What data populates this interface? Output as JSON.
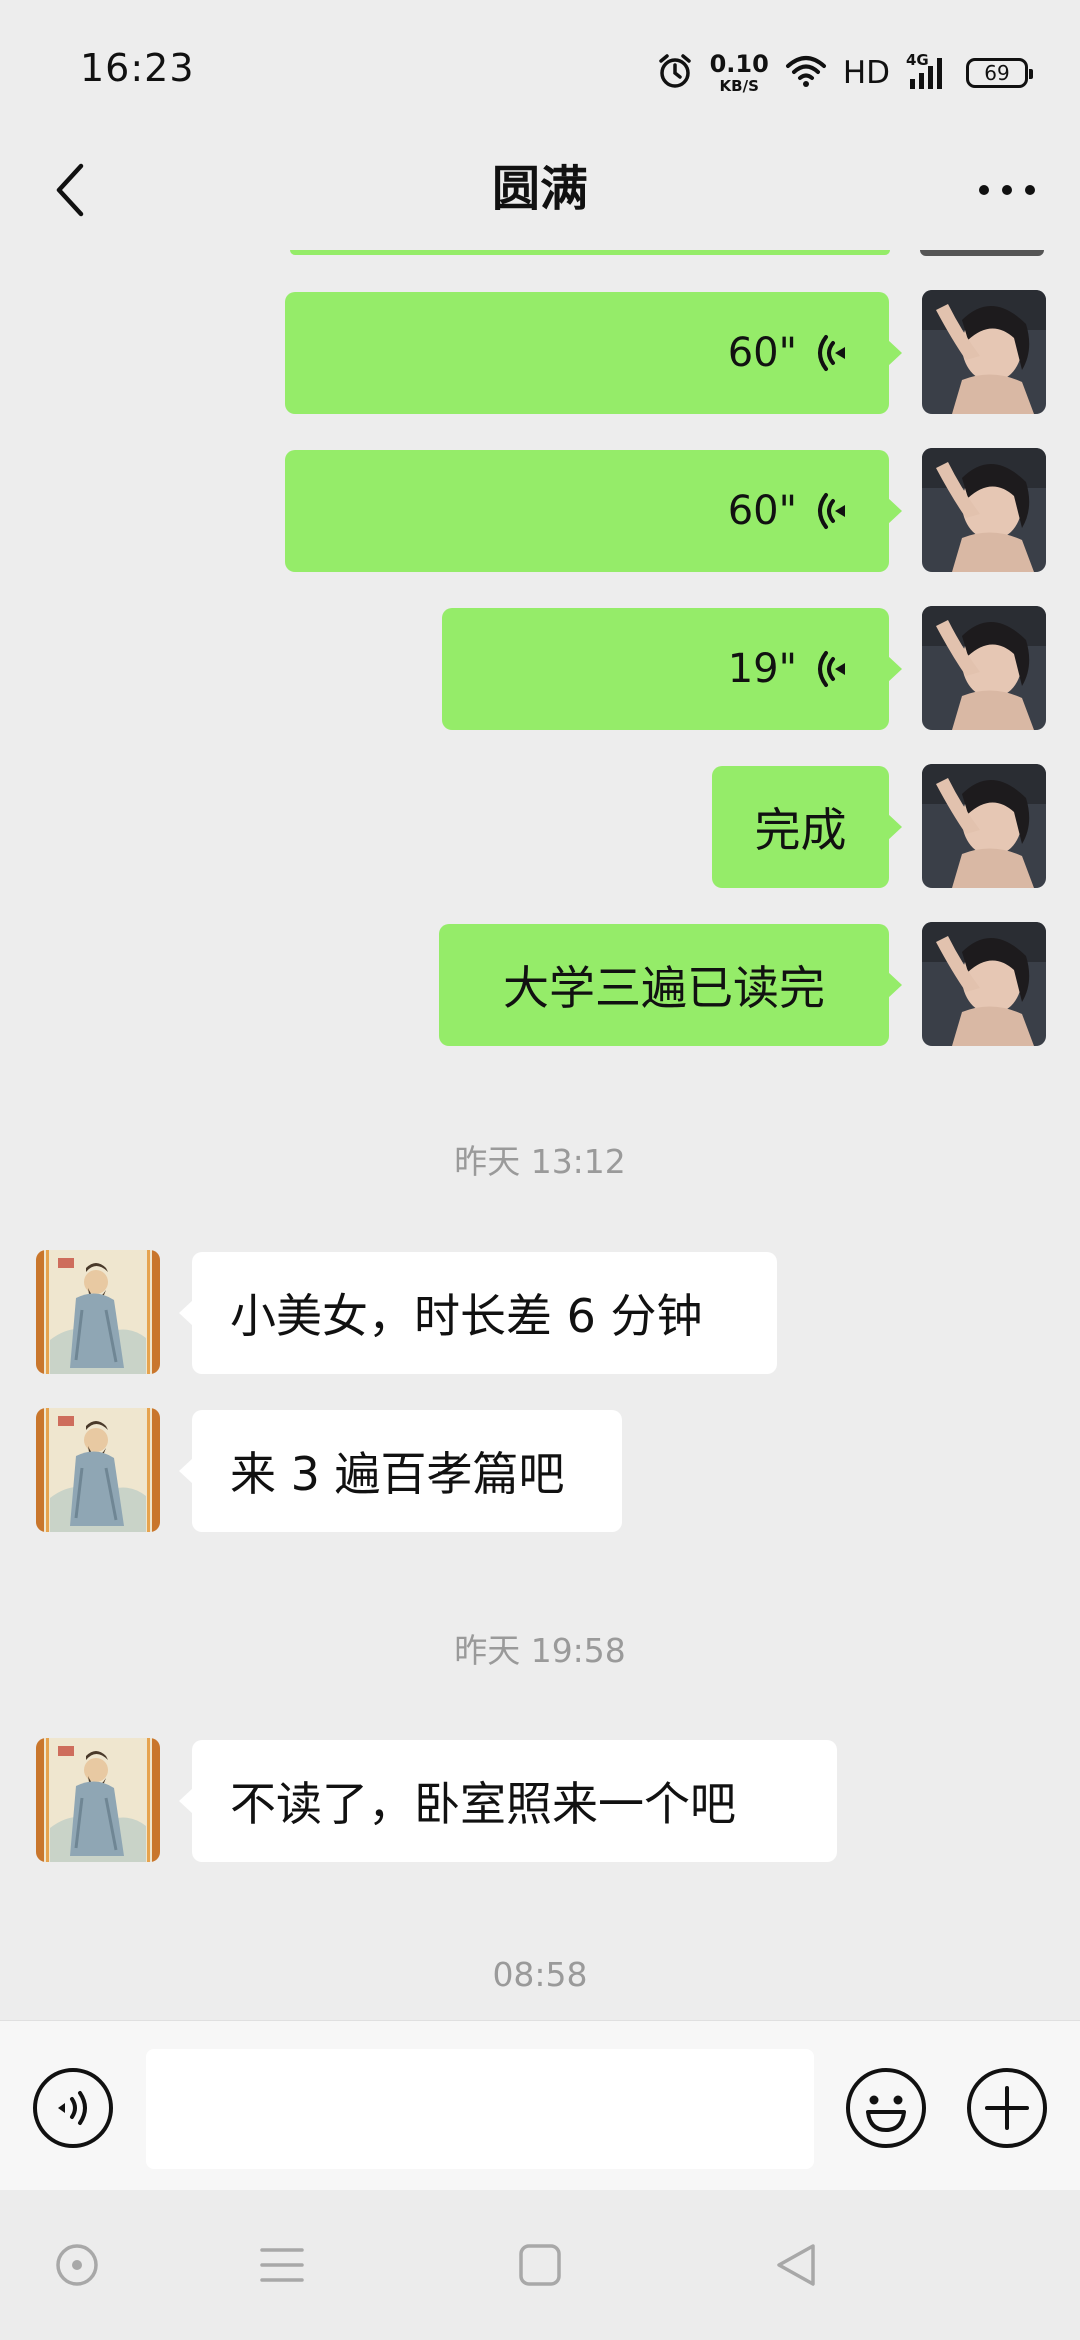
{
  "status_bar": {
    "time": "16:23",
    "net_speed": "0.10",
    "net_unit": "KB/S",
    "hd": "HD",
    "network": "4G",
    "battery": "69"
  },
  "header": {
    "title": "圆满"
  },
  "messages": [
    {
      "dir": "out",
      "type": "voice",
      "duration": "60\""
    },
    {
      "dir": "out",
      "type": "voice",
      "duration": "60\""
    },
    {
      "dir": "out",
      "type": "voice",
      "duration": "19\""
    },
    {
      "dir": "out",
      "type": "text",
      "text": "完成"
    },
    {
      "dir": "out",
      "type": "text",
      "text": "大学三遍已读完"
    },
    {
      "type": "time",
      "text": "昨天 13:12"
    },
    {
      "dir": "in",
      "type": "text",
      "text": "小美女，时长差 6 分钟"
    },
    {
      "dir": "in",
      "type": "text",
      "text": "来 3 遍百孝篇吧"
    },
    {
      "type": "time",
      "text": "昨天 19:58"
    },
    {
      "dir": "in",
      "type": "text",
      "text": "不读了，卧室照来一个吧"
    },
    {
      "type": "time",
      "text": "08:58"
    }
  ],
  "input": {
    "value": "",
    "placeholder": ""
  },
  "icons": {
    "back": "chevron-left-icon",
    "more": "more-dots-icon",
    "voice_input": "voice-input-icon",
    "emoji": "emoji-icon",
    "add": "plus-icon",
    "alarm": "alarm-icon",
    "wifi": "wifi-icon",
    "signal": "signal-icon"
  },
  "colors": {
    "background": "#ededed",
    "outgoing_bubble": "#95ec69",
    "incoming_bubble": "#ffffff",
    "timestamp": "#9a9a9a"
  }
}
